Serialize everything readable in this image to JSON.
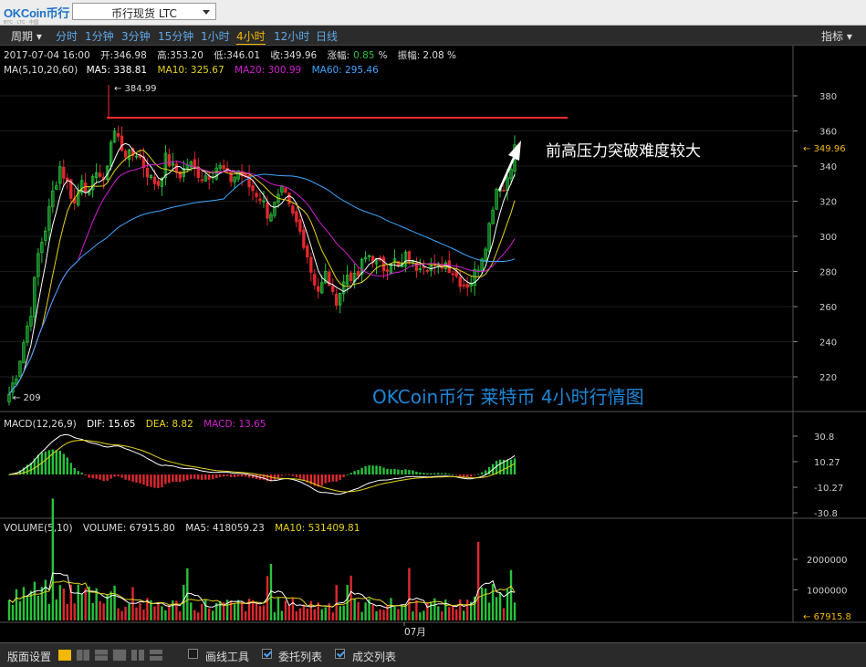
{
  "logo": "OKCoin币行",
  "symbol_select": "币行现货 LTC",
  "periods_menu": "周期",
  "timeframes": [
    "分时",
    "1分钟",
    "3分钟",
    "15分钟",
    "1小时",
    "4小时",
    "12小时",
    "日线"
  ],
  "active_timeframe": "4小时",
  "indicators_menu": "指标",
  "info": {
    "date": "2017-07-04 16:00",
    "open_label": "开:",
    "open": "346.98",
    "high_label": "高:",
    "high": "353.20",
    "low_label": "低:",
    "low": "346.01",
    "close_label": "收:",
    "close": "349.96",
    "change_label": "涨幅:",
    "change": "0.85",
    "change_unit": "%",
    "amp_label": "振幅:",
    "amp": "2.08 %"
  },
  "ma": {
    "label": "MA(5,10,20,60)",
    "ma5": "MA5: 338.81",
    "ma10": "MA10: 325.67",
    "ma20": "MA20: 300.99",
    "ma60": "MA60: 295.46"
  },
  "price_axis": [
    "380",
    "360",
    "340",
    "320",
    "300",
    "280",
    "260",
    "240",
    "220"
  ],
  "current_price": "349.96",
  "high_marker": "← 384.99",
  "low_marker": "← 209",
  "annotation": "前高压力突破难度较大",
  "watermark": "OKCoin币行  莱特币  4小时行情图",
  "macd": {
    "label": "MACD(12,26,9)",
    "dif": "DIF: 15.65",
    "dea": "DEA: 8.82",
    "macd": "MACD: 13.65",
    "axis": [
      "30.8",
      "10.27",
      "-10.27",
      "-30.8"
    ]
  },
  "volume": {
    "label": "VOLUME(5,10)",
    "volume": "VOLUME: 67915.80",
    "ma5": "MA5: 418059.23",
    "ma10": "MA10: 531409.81",
    "axis": [
      "2000000",
      "1000000"
    ],
    "current": "67915.8"
  },
  "x_label": "07月",
  "bottom": {
    "layout_label": "版面设置",
    "draw_tools": "画线工具",
    "orders": "委托列表",
    "trades": "成交列表"
  },
  "colors": {
    "up": "#27c33b",
    "down": "#e0282e",
    "ma5": "#ffffff",
    "ma10": "#e6d31a",
    "ma20": "#d21ed2",
    "ma60": "#3ea6ff",
    "accent": "#f5b800"
  }
}
